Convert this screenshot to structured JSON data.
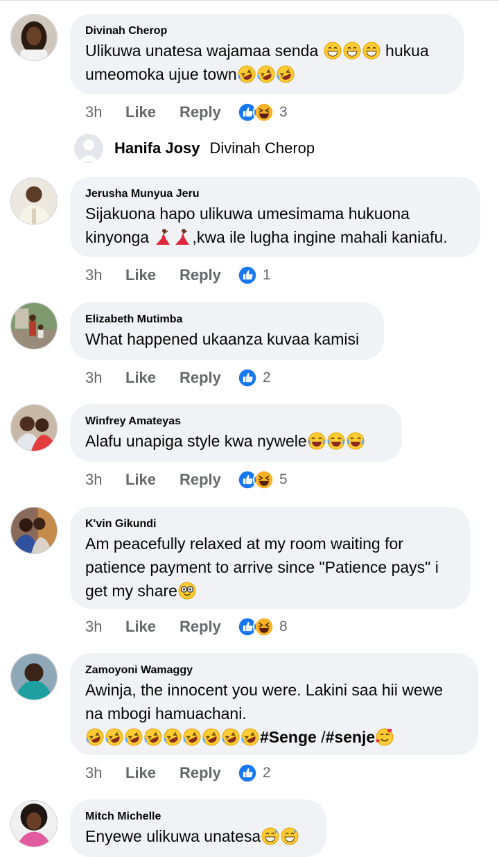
{
  "comments": [
    {
      "author": "Divinah Cherop",
      "lines": [
        [
          "Ulikuwa unatesa wajamaa senda "
        ],
        [
          "umeomoka ujue town"
        ]
      ],
      "line1_after": " hukua",
      "time": "3h",
      "like": "Like",
      "reply": "Reply",
      "count": "3",
      "reactions": [
        "like-reaction-icon",
        "haha-reaction-icon"
      ]
    },
    {
      "author": "Jerusha Munyua Jeru",
      "line1": "Sijakuona hapo ulikuwa umesimama hukuona",
      "line2_before": "kinyonga ",
      "line2_after": ",kwa ile lugha ingine mahali kaniafu.",
      "time": "3h",
      "like": "Like",
      "reply": "Reply",
      "count": "1",
      "reactions": [
        "like-reaction-icon"
      ]
    },
    {
      "author": "Elizabeth Mutimba",
      "line1": "What happened ukaanza kuvaa kamisi",
      "time": "3h",
      "like": "Like",
      "reply": "Reply",
      "count": "2",
      "reactions": [
        "like-reaction-icon"
      ]
    },
    {
      "author": "Winfrey Amateyas",
      "line1": "Alafu unapiga  style kwa nywele",
      "time": "3h",
      "like": "Like",
      "reply": "Reply",
      "count": "5",
      "reactions": [
        "like-reaction-icon",
        "haha-reaction-icon"
      ]
    },
    {
      "author": "K'vin Gikundi",
      "line1": "Am peacefully relaxed at my room waiting for",
      "line2": "patience payment to arrive since \"Patience pays\" i",
      "line3": "get my share",
      "time": "3h",
      "like": "Like",
      "reply": "Reply",
      "count": "8",
      "reactions": [
        "like-reaction-icon",
        "haha-reaction-icon"
      ]
    },
    {
      "author": "Zamoyoni Wamaggy",
      "line1": "Awinja,  the innocent you were. Lakini saa hii wewe",
      "line2": "na mbogi hamuachani.",
      "hashtag1": "#Senge",
      "between": "  /",
      "hashtag2": "#senje",
      "time": "3h",
      "like": "Like",
      "reply": "Reply",
      "count": "2",
      "reactions": [
        "like-reaction-icon"
      ]
    },
    {
      "author": "Mitch Michelle",
      "line1": "Enyewe ulikuwa unatesa"
    }
  ],
  "reply_preview": {
    "replier": "Hanifa Josy",
    "tagged": "Divinah Cherop"
  },
  "colors": {
    "bubble": "#f0f2f5",
    "secondary_text": "#65676b",
    "like_blue": "#1877f2",
    "haha_yellow": "#f7b125"
  }
}
